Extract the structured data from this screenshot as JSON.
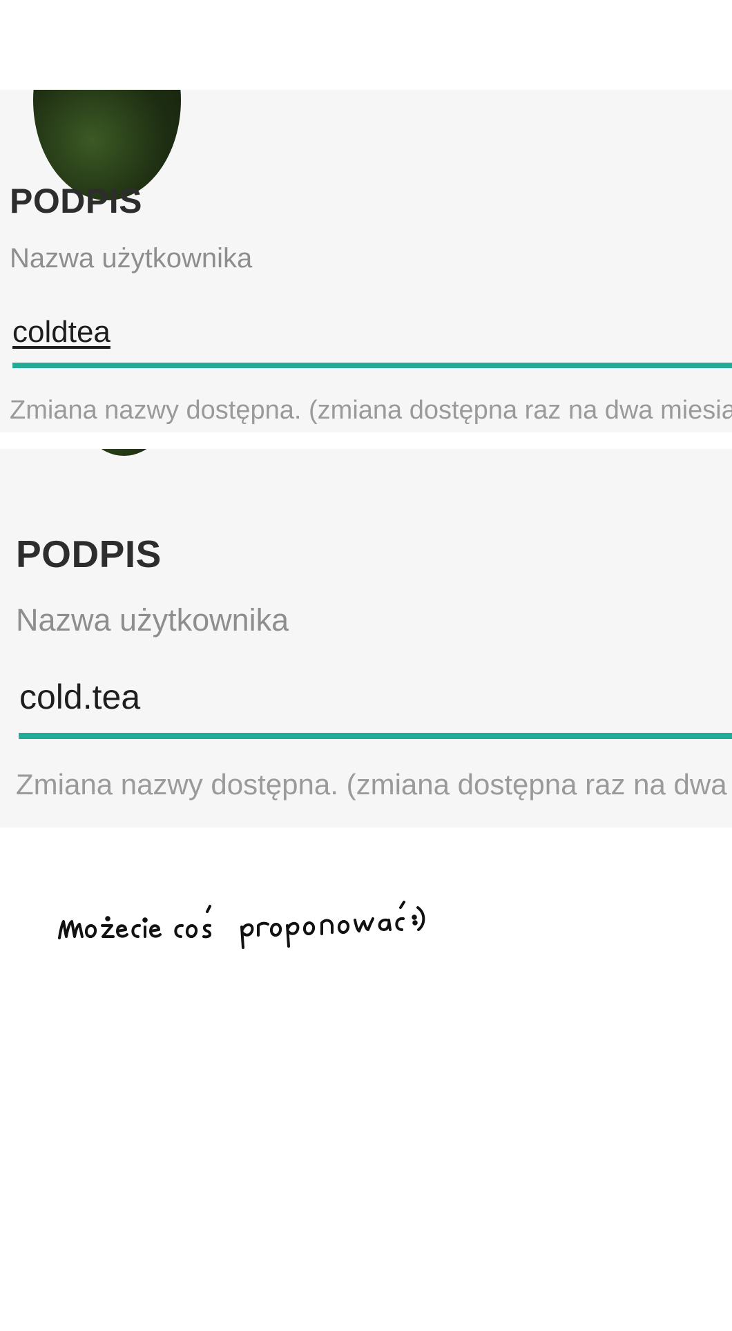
{
  "screenshots": [
    {
      "section_title": "PODPIS",
      "field_label": "Nazwa użytkownika",
      "field_value": "coldtea",
      "helper_text": "Zmiana nazwy dostępna. (zmiana dostępna raz na dwa miesia"
    },
    {
      "section_title": "PODPIS",
      "field_label": "Nazwa użytkownika",
      "field_value": "cold.tea",
      "helper_text": "Zmiana nazwy dostępna. (zmiana dostępna raz na dwa"
    }
  ],
  "handwritten_note": "możecie coś proponować :)",
  "colors": {
    "accent": "#22ab96",
    "panel_background": "#f6f6f6",
    "page_background": "#ffffff"
  }
}
